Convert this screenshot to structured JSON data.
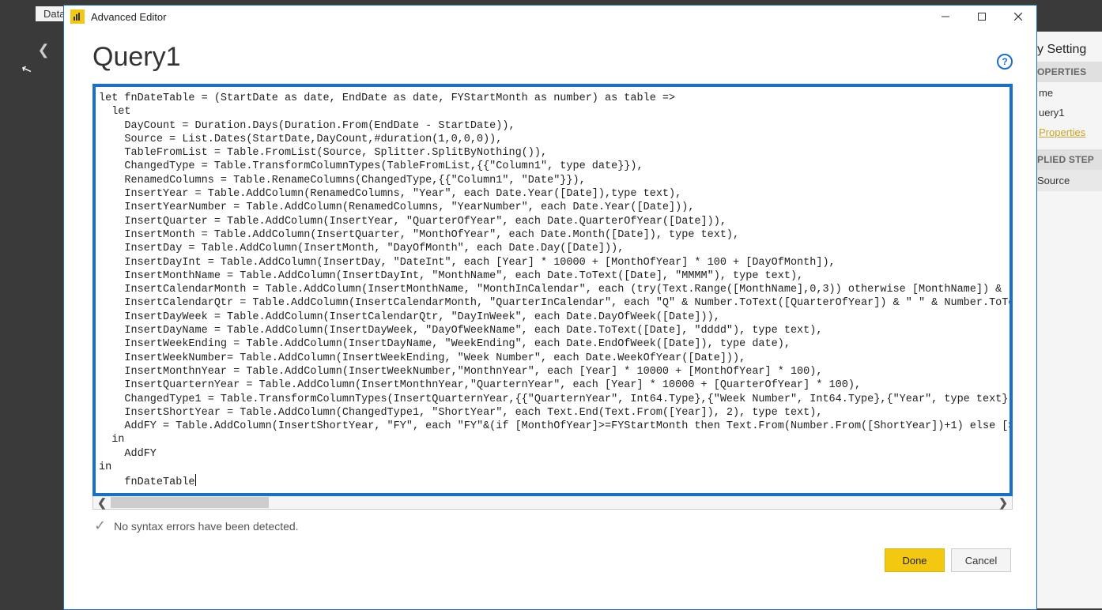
{
  "background": {
    "tab_label": "Data"
  },
  "right_panel": {
    "title": "y Setting",
    "section_properties": "OPERTIES",
    "name_label": "me",
    "name_value": "uery1",
    "all_properties": "Properties",
    "section_applied": "PLIED STEP",
    "step_source": "Source"
  },
  "modal": {
    "titlebar": "Advanced Editor",
    "min_tooltip": "Minimize",
    "max_tooltip": "Maximize",
    "close_tooltip": "Close",
    "query_title": "Query1",
    "help_tooltip": "Help",
    "status_text": "No syntax errors have been detected.",
    "done_label": "Done",
    "cancel_label": "Cancel",
    "code": "let fnDateTable = (StartDate as date, EndDate as date, FYStartMonth as number) as table =>\n  let\n    DayCount = Duration.Days(Duration.From(EndDate - StartDate)),\n    Source = List.Dates(StartDate,DayCount,#duration(1,0,0,0)),\n    TableFromList = Table.FromList(Source, Splitter.SplitByNothing()),\n    ChangedType = Table.TransformColumnTypes(TableFromList,{{\"Column1\", type date}}),\n    RenamedColumns = Table.RenameColumns(ChangedType,{{\"Column1\", \"Date\"}}),\n    InsertYear = Table.AddColumn(RenamedColumns, \"Year\", each Date.Year([Date]),type text),\n    InsertYearNumber = Table.AddColumn(RenamedColumns, \"YearNumber\", each Date.Year([Date])),\n    InsertQuarter = Table.AddColumn(InsertYear, \"QuarterOfYear\", each Date.QuarterOfYear([Date])),\n    InsertMonth = Table.AddColumn(InsertQuarter, \"MonthOfYear\", each Date.Month([Date]), type text),\n    InsertDay = Table.AddColumn(InsertMonth, \"DayOfMonth\", each Date.Day([Date])),\n    InsertDayInt = Table.AddColumn(InsertDay, \"DateInt\", each [Year] * 10000 + [MonthOfYear] * 100 + [DayOfMonth]),\n    InsertMonthName = Table.AddColumn(InsertDayInt, \"MonthName\", each Date.ToText([Date], \"MMMM\"), type text),\n    InsertCalendarMonth = Table.AddColumn(InsertMonthName, \"MonthInCalendar\", each (try(Text.Range([MonthName],0,3)) otherwise [MonthName]) & \"\n    InsertCalendarQtr = Table.AddColumn(InsertCalendarMonth, \"QuarterInCalendar\", each \"Q\" & Number.ToText([QuarterOfYear]) & \" \" & Number.ToTe\n    InsertDayWeek = Table.AddColumn(InsertCalendarQtr, \"DayInWeek\", each Date.DayOfWeek([Date])),\n    InsertDayName = Table.AddColumn(InsertDayWeek, \"DayOfWeekName\", each Date.ToText([Date], \"dddd\"), type text),\n    InsertWeekEnding = Table.AddColumn(InsertDayName, \"WeekEnding\", each Date.EndOfWeek([Date]), type date),\n    InsertWeekNumber= Table.AddColumn(InsertWeekEnding, \"Week Number\", each Date.WeekOfYear([Date])),\n    InsertMonthnYear = Table.AddColumn(InsertWeekNumber,\"MonthnYear\", each [Year] * 10000 + [MonthOfYear] * 100),\n    InsertQuarternYear = Table.AddColumn(InsertMonthnYear,\"QuarternYear\", each [Year] * 10000 + [QuarterOfYear] * 100),\n    ChangedType1 = Table.TransformColumnTypes(InsertQuarternYear,{{\"QuarternYear\", Int64.Type},{\"Week Number\", Int64.Type},{\"Year\", type text},\n    InsertShortYear = Table.AddColumn(ChangedType1, \"ShortYear\", each Text.End(Text.From([Year]), 2), type text),\n    AddFY = Table.AddColumn(InsertShortYear, \"FY\", each \"FY\"&(if [MonthOfYear]>=FYStartMonth then Text.From(Number.From([ShortYear])+1) else [S\n  in\n    AddFY\nin\n    fnDateTable"
  }
}
